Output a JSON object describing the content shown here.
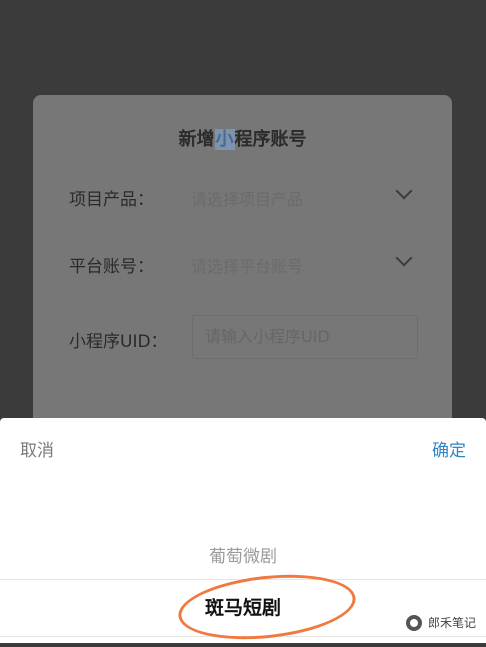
{
  "dialog": {
    "title_prefix": "新增",
    "title_highlight": "小",
    "title_suffix": "程序账号",
    "fields": [
      {
        "label": "项目产品：",
        "placeholder": "请选择项目产品"
      },
      {
        "label": "平台账号：",
        "placeholder": "请选择平台账号"
      },
      {
        "label": "小程序UID：",
        "placeholder": "请输入小程序UID"
      }
    ]
  },
  "picker": {
    "cancel_label": "取消",
    "confirm_label": "确定",
    "options": [
      "葡萄微剧",
      "斑马短剧"
    ],
    "selected": "斑马短剧"
  },
  "watermark": {
    "text": "郎禾笔记"
  },
  "colors": {
    "confirm": "#2f86c4",
    "annotation_circle": "#f0793f"
  }
}
